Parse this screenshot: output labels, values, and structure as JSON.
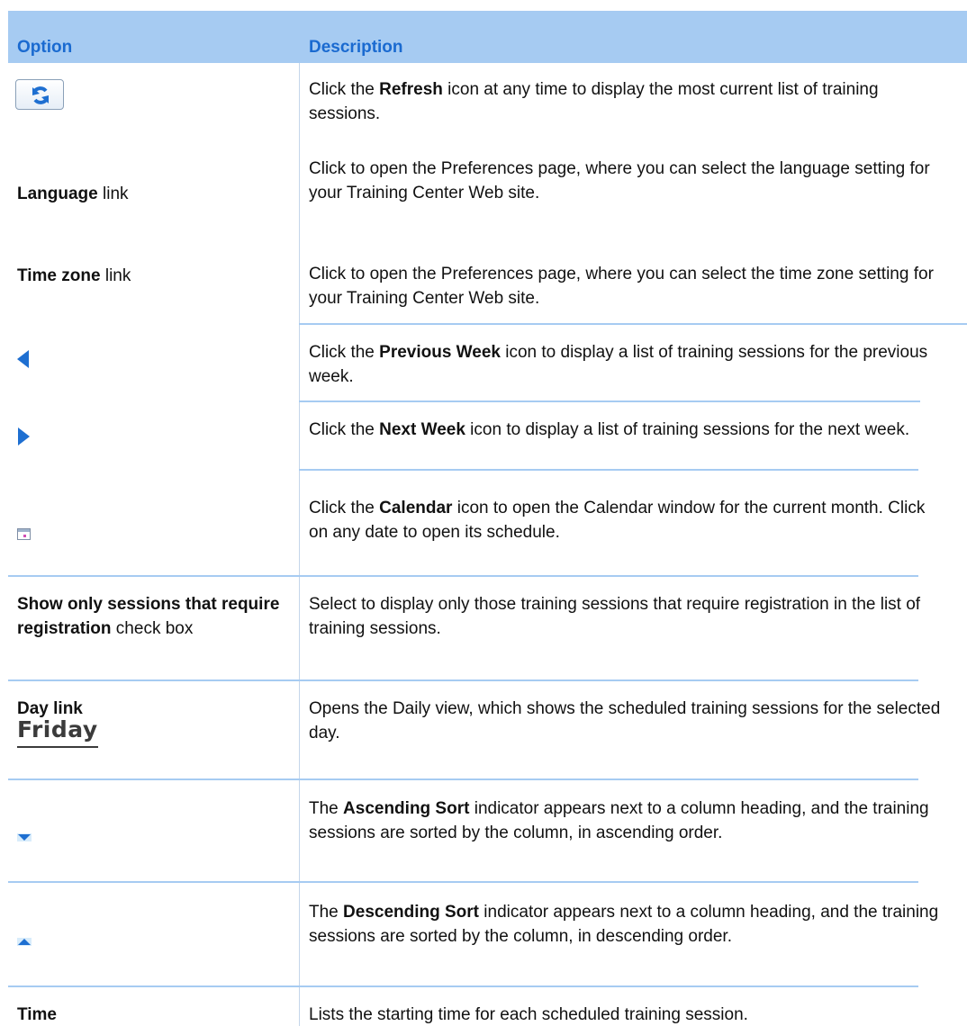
{
  "header": {
    "option": "Option",
    "description": "Description"
  },
  "rows": [
    {
      "option_icon": "refresh-icon",
      "desc": {
        "pre": "Click the ",
        "bold": "Refresh",
        "post": " icon at any time to display the most current list of training sessions."
      }
    },
    {
      "option": {
        "bold": "Language",
        "post": " link"
      },
      "desc": {
        "text": "Click to open the Preferences page, where you can select the language setting for your Training Center Web site."
      }
    },
    {
      "option": {
        "bold": "Time zone",
        "post": " link"
      },
      "desc": {
        "text": "Click to open the Preferences page, where you can select the time zone setting for your Training Center Web site."
      }
    },
    {
      "option_icon": "previous-week-icon",
      "desc": {
        "pre": "Click the ",
        "bold": "Previous Week",
        "post": " icon to display a list of training sessions for the previous week."
      }
    },
    {
      "option_icon": "next-week-icon",
      "desc": {
        "pre": "Click the ",
        "bold": "Next Week",
        "post": " icon to display a list of training sessions for the next week."
      }
    },
    {
      "option_icon": "calendar-icon",
      "desc": {
        "pre": "Click the ",
        "bold": "Calendar",
        "post": " icon to open the Calendar window for the current month. Click on any date to open its schedule."
      }
    },
    {
      "option": {
        "bold": "Show only sessions that require registration",
        "post": " check box"
      },
      "desc": {
        "text": "Select to display only those training sessions that require registration in the list of training sessions."
      }
    },
    {
      "option": {
        "bold": "Day link"
      },
      "option_image_text": "Friday",
      "desc": {
        "text": "Opens the Daily view, which shows the scheduled training sessions for the selected day."
      }
    },
    {
      "option_icon": "ascending-sort-icon",
      "desc": {
        "pre": "The ",
        "bold": "Ascending Sort",
        "post": " indicator appears next to a column heading, and the training sessions are sorted by the column, in ascending order."
      }
    },
    {
      "option_icon": "descending-sort-icon",
      "desc": {
        "pre": "The ",
        "bold": "Descending Sort",
        "post": " indicator appears next to a column heading, and the training sessions are sorted by the column, in descending order."
      }
    },
    {
      "option": {
        "bold": "Time"
      },
      "desc": {
        "text": "Lists the starting time for each scheduled training session."
      }
    }
  ],
  "colors": {
    "header_band": "#a6cbf2",
    "header_text": "#1a6ad0",
    "icon_blue": "#1e6fd1"
  }
}
